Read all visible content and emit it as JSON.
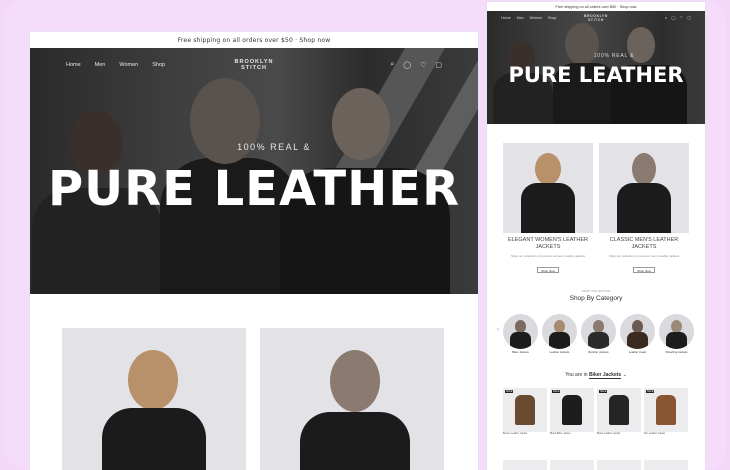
{
  "announcement": "Free shipping on all orders over $50 · Shop now",
  "nav": {
    "items": [
      "Home",
      "Men",
      "Women",
      "Shop"
    ],
    "logo_line1": "BROOKLYN",
    "logo_line2": "STITCH"
  },
  "hero": {
    "subtitle": "100% REAL &",
    "title": "PURE LEATHER"
  },
  "cards": [
    {
      "caption": "ELEGANT WOMEN'S LEATHER JACKETS",
      "desc": "Shop our collection of premium women's leather jackets",
      "button": "Shop Now"
    },
    {
      "caption": "CLASSIC MEN'S LEATHER JACKETS",
      "desc": "Shop our collection of premium men's leather jackets",
      "button": "Shop Now"
    }
  ],
  "categories": {
    "tag": "SHOP COLLECTION",
    "title": "Shop By Category",
    "items": [
      "Biker Jackets",
      "Leather Jackets",
      "Bomber Jackets",
      "Leather Coats",
      "Shearling Jackets"
    ]
  },
  "you_are_in": {
    "prefix": "You are in",
    "value": "Biker Jackets"
  },
  "products": [
    {
      "badge": "SALE",
      "label": "Brown Leather Jacket"
    },
    {
      "badge": "SALE",
      "label": "Black Biker Jacket"
    },
    {
      "badge": "SALE",
      "label": "Black Leather Jacket"
    },
    {
      "badge": "SALE",
      "label": "Tan Leather Jacket"
    }
  ],
  "colors": {
    "accent": "#f3d8fa",
    "hero_dark": "#2b2b2b",
    "card_bg": "#e3e3e7"
  }
}
